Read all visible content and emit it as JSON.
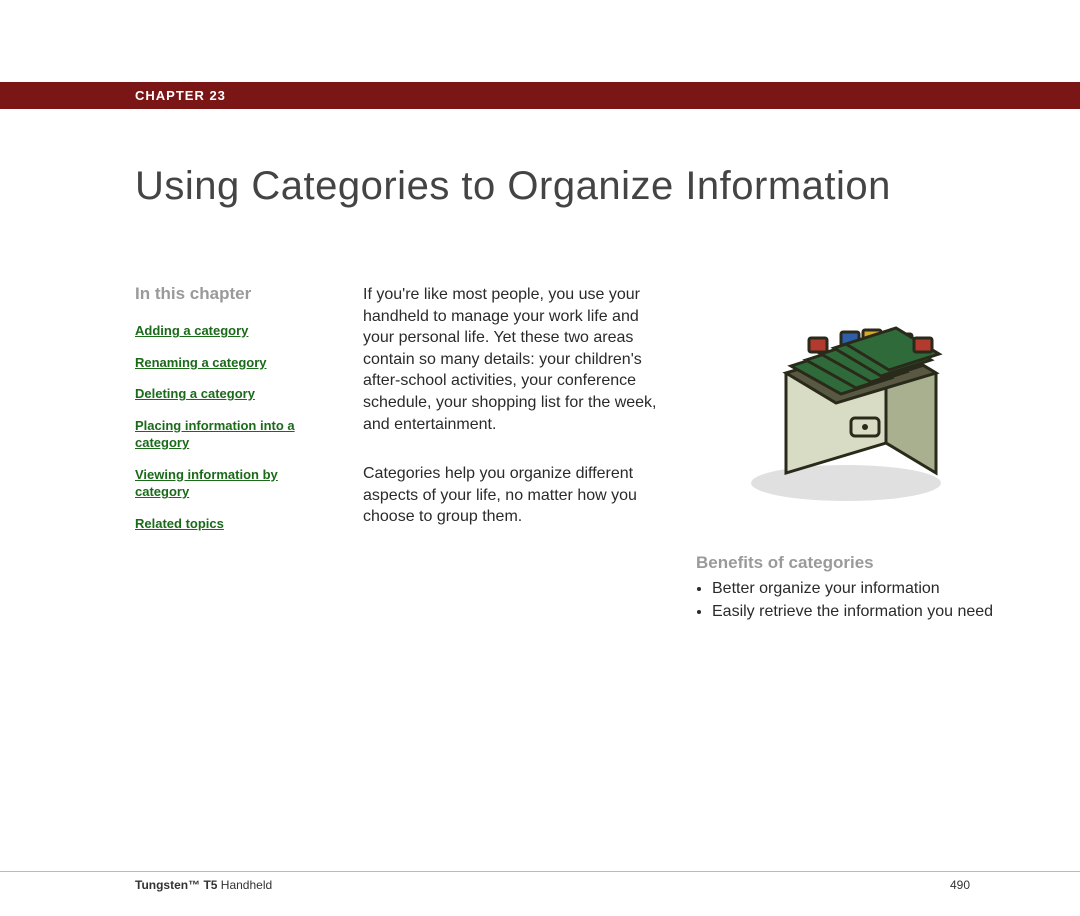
{
  "chapter_label": "CHAPTER 23",
  "title": "Using Categories to Organize Information",
  "sidebar": {
    "heading": "In this chapter",
    "links": {
      "l0": "Adding a category",
      "l1": "Renaming a category",
      "l2": "Deleting a category",
      "l3": "Placing information into a category",
      "l4": "Viewing information by category",
      "l5": "Related topics"
    }
  },
  "body": {
    "p1": "If you're like most people, you use your handheld to manage your work life and your personal life. Yet these two areas contain so many details: your children's after-school activities, your conference schedule, your shopping list for the week, and entertainment.",
    "p2": "Categories help you organize different aspects of your life, no matter how you choose to group them."
  },
  "benefits": {
    "heading": "Benefits of categories",
    "items": {
      "b0": "Better organize your information",
      "b1": "Easily retrieve the information you need"
    }
  },
  "footer": {
    "product_bold": "Tungsten™ T5",
    "product_rest": " Handheld",
    "page": "490"
  }
}
